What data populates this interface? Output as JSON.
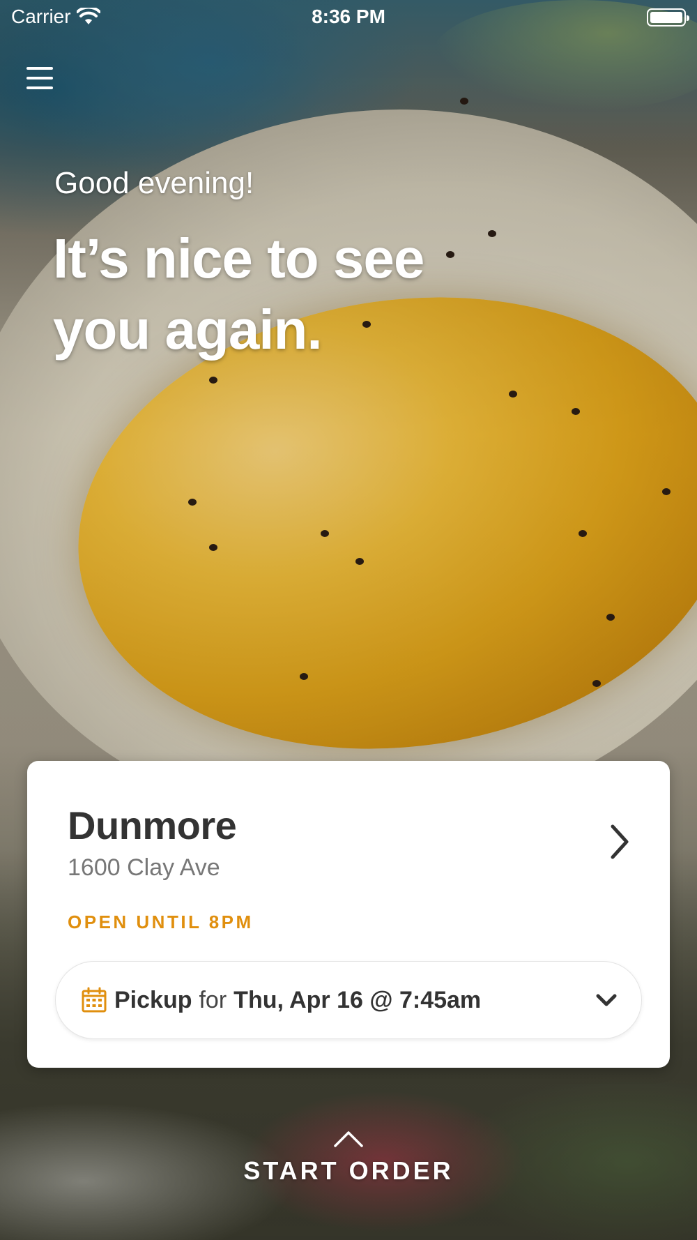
{
  "status_bar": {
    "carrier": "Carrier",
    "time": "8:36 PM",
    "icons": [
      "wifi-icon",
      "battery-icon"
    ]
  },
  "menu": {
    "icon": "menu-icon"
  },
  "greeting": {
    "salutation": "Good evening!",
    "headline_line1": "It’s nice to see",
    "headline_line2": "you again."
  },
  "location": {
    "name": "Dunmore",
    "address": "1600 Clay Ave",
    "hours": "OPEN UNTIL 8PM",
    "chevron_icon": "chevron-right-icon"
  },
  "order_time": {
    "icon": "calendar-icon",
    "mode": "Pickup",
    "connector": "for",
    "time": "Thu, Apr 16 @ 7:45am",
    "dropdown_icon": "chevron-down-icon"
  },
  "start_order": {
    "icon": "caret-up-icon",
    "label": "START ORDER"
  },
  "colors": {
    "accent": "#e08f0e",
    "text_dark": "#333333",
    "text_muted": "#777777",
    "card_bg": "#ffffff"
  }
}
